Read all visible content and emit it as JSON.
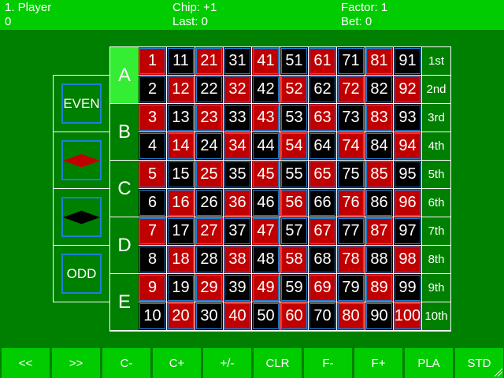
{
  "hud": {
    "player": "1. Player",
    "score": "0",
    "chip": "Chip: +1",
    "last": "Last: 0",
    "factor": "Factor: 1",
    "bet": "Bet: 0"
  },
  "side": {
    "even": "EVEN",
    "odd": "ODD",
    "red_color": "#c00000",
    "black_color": "#000000"
  },
  "board": {
    "letters": [
      "A",
      "B",
      "C",
      "D",
      "E"
    ],
    "selected_letter": "A",
    "rows": [
      "1st",
      "2nd",
      "3rd",
      "4th",
      "5th",
      "6th",
      "7th",
      "8th",
      "9th",
      "10th"
    ],
    "numbers": [
      [
        "1",
        "11",
        "21",
        "31",
        "41",
        "51",
        "61",
        "71",
        "81",
        "91"
      ],
      [
        "2",
        "12",
        "22",
        "32",
        "42",
        "52",
        "62",
        "72",
        "82",
        "92"
      ],
      [
        "3",
        "13",
        "23",
        "33",
        "43",
        "53",
        "63",
        "73",
        "83",
        "93"
      ],
      [
        "4",
        "14",
        "24",
        "34",
        "44",
        "54",
        "64",
        "74",
        "84",
        "94"
      ],
      [
        "5",
        "15",
        "25",
        "35",
        "45",
        "55",
        "65",
        "75",
        "85",
        "95"
      ],
      [
        "6",
        "16",
        "26",
        "36",
        "46",
        "56",
        "66",
        "76",
        "86",
        "96"
      ],
      [
        "7",
        "17",
        "27",
        "37",
        "47",
        "57",
        "67",
        "77",
        "87",
        "97"
      ],
      [
        "8",
        "18",
        "28",
        "38",
        "48",
        "58",
        "68",
        "78",
        "88",
        "98"
      ],
      [
        "9",
        "19",
        "29",
        "39",
        "49",
        "59",
        "69",
        "79",
        "89",
        "99"
      ],
      [
        "10",
        "20",
        "30",
        "40",
        "50",
        "60",
        "70",
        "80",
        "90",
        "100"
      ]
    ],
    "red_color": "#c00000",
    "black_color": "#000000",
    "highlight_color": "#1e7fd6"
  },
  "toolbar": [
    "<<",
    ">>",
    "C-",
    "C+",
    "+/-",
    "CLR",
    "F-",
    "F+",
    "PLA",
    "STD"
  ]
}
